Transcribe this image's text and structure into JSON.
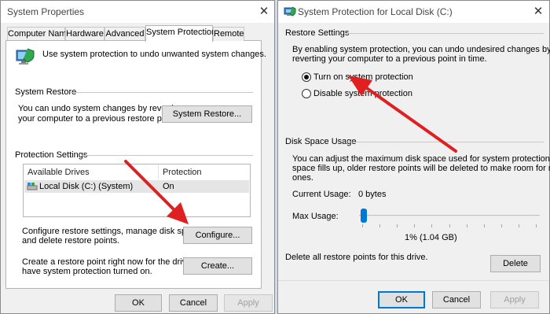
{
  "left_window": {
    "title": "System Properties",
    "tabs": [
      "Computer Name",
      "Hardware",
      "Advanced",
      "System Protection",
      "Remote"
    ],
    "active_tab": "System Protection",
    "intro_text": "Use system protection to undo unwanted system changes.",
    "system_restore": {
      "section_label": "System Restore",
      "description_line1": "You can undo system changes by reverting",
      "description_line2": "your computer to a previous restore point.",
      "button": "System Restore..."
    },
    "protection_settings": {
      "section_label": "Protection Settings",
      "columns": [
        "Available Drives",
        "Protection"
      ],
      "rows": [
        {
          "drive": "Local Disk (C:) (System)",
          "protection": "On"
        }
      ],
      "configure_line1": "Configure restore settings, manage disk space,",
      "configure_line2": "and delete restore points.",
      "configure_button": "Configure...",
      "create_line1": "Create a restore point right now for the drives that",
      "create_line2": "have system protection turned on.",
      "create_button": "Create..."
    },
    "footer": {
      "ok": "OK",
      "cancel": "Cancel",
      "apply": "Apply"
    }
  },
  "right_window": {
    "title": "System Protection for Local Disk (C:)",
    "restore_settings": {
      "section_label": "Restore Settings",
      "description_line1": "By enabling system protection, you can undo undesired changes by",
      "description_line2": "reverting your computer to a previous point in time.",
      "option_on": "Turn on system protection",
      "option_off": "Disable system protection",
      "selected": "on"
    },
    "disk_space": {
      "section_label": "Disk Space Usage",
      "description_line1": "You can adjust the maximum disk space used for system protection. As",
      "description_line2": "space fills up, older restore points will be deleted to make room for new",
      "description_line3": "ones.",
      "current_usage_label": "Current Usage:",
      "current_usage_value": "0 bytes",
      "max_usage_label": "Max Usage:",
      "max_usage_fraction": 0.01,
      "max_usage_value": "1% (1.04 GB)",
      "delete_text": "Delete all restore points for this drive.",
      "delete_button": "Delete"
    },
    "footer": {
      "ok": "OK",
      "cancel": "Cancel",
      "apply": "Apply"
    }
  },
  "annotation_color": "#e02020",
  "accent_color": "#0078d7"
}
